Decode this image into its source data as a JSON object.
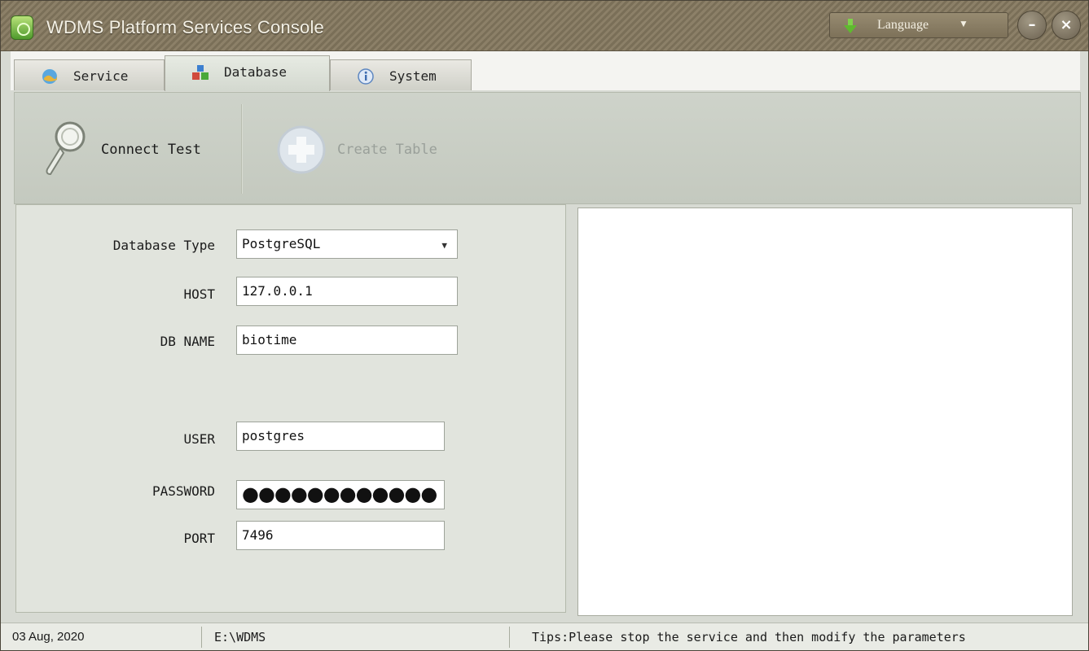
{
  "window": {
    "title": "WDMS Platform Services Console",
    "language_label": "Language",
    "minimize_glyph": "–",
    "close_glyph": "×"
  },
  "tabs": [
    {
      "label": "Service",
      "icon": "globe-icon",
      "active": false
    },
    {
      "label": "Database",
      "icon": "database-icon",
      "active": true
    },
    {
      "label": "System",
      "icon": "info-icon",
      "active": false
    }
  ],
  "toolbar": {
    "connect_test_label": "Connect Test",
    "create_table_label": "Create Table",
    "create_table_enabled": false
  },
  "form": {
    "database_type": {
      "label": "Database Type",
      "value": "PostgreSQL"
    },
    "host": {
      "label": "HOST",
      "value": "127.0.0.1"
    },
    "db_name": {
      "label": "DB NAME",
      "value": "biotime"
    },
    "user": {
      "label": "USER",
      "value": "postgres"
    },
    "password": {
      "label": "PASSWORD",
      "value": "●●●●●●●●●●●●"
    },
    "port": {
      "label": "PORT",
      "value": "7496"
    }
  },
  "statusbar": {
    "date": "03 Aug, 2020",
    "path": "E:\\WDMS",
    "tips": "Tips:Please stop the service and then modify the parameters"
  },
  "colors": {
    "titlebar": "#857a63",
    "panel": "#e1e4dd",
    "toolbar": "#c9cec4",
    "accent_green": "#4f9a2c"
  }
}
